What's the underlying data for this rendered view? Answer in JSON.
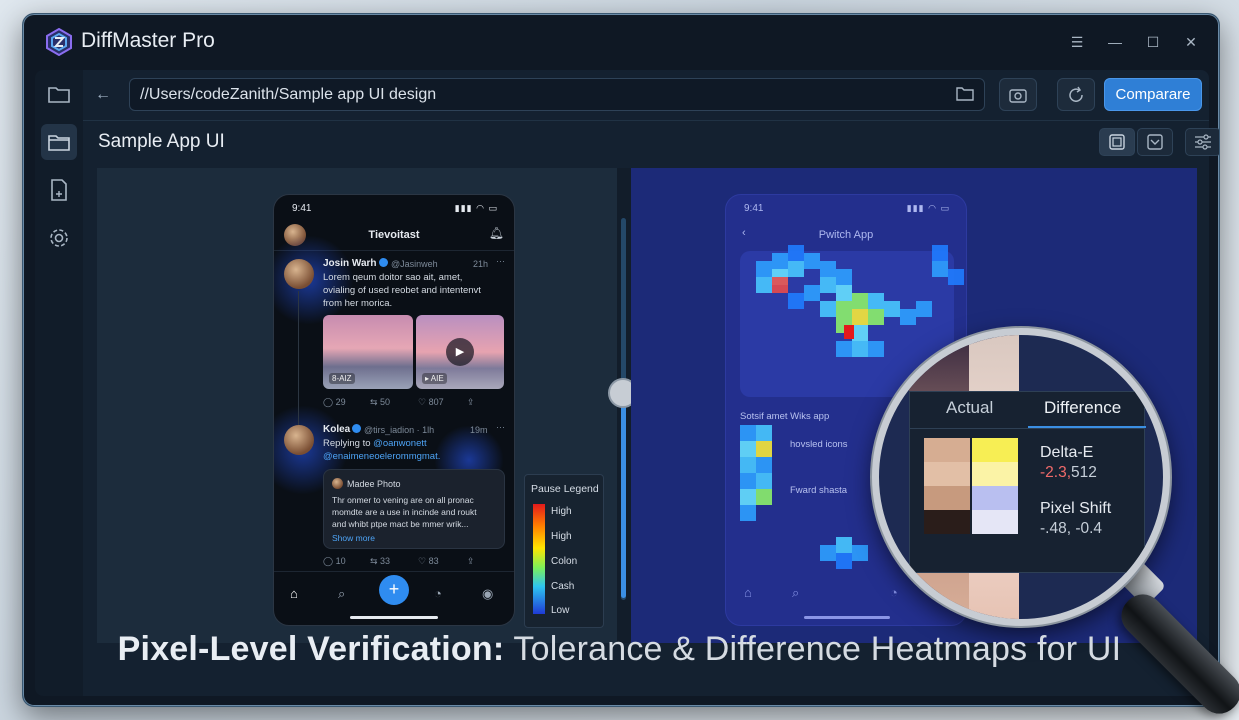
{
  "app": {
    "title": "DiffMaster Pro"
  },
  "toolbar": {
    "path": "//Users/codeZanith/Sample app UI design",
    "compare_label": "Comparare"
  },
  "subbar": {
    "title": "Sample App UI"
  },
  "left_phone": {
    "time": "9:41",
    "header_title": "Tievoitast",
    "post1": {
      "name": "Josin Warh",
      "handle": "@Jasinweh",
      "age": "21h",
      "text_lines": [
        "Lorem qeum doitor sao ait, amet,",
        "ovialing of used reobet and intentenvt",
        "from her morica."
      ],
      "img1_tag": "8-AIZ",
      "img2_tag": "▸ AIE",
      "actions": [
        "29",
        "50",
        "807"
      ]
    },
    "post2": {
      "name": "Kolea",
      "handle": "@tirs_iadion · 1lh",
      "age": "19m",
      "reply_label": "Replying to",
      "reply_to": "@oanwonett",
      "reply_line2": "@enaimeneoelerommgmat.",
      "quote_name": "Madee Photo",
      "quote_lines": [
        "Thr onmer to vening are on all pronac",
        "momdte are a use in incinde and roukt",
        "and whibt ptpe mact be mmer wrik..."
      ],
      "show_more": "Show more",
      "actions": [
        "10",
        "33",
        "83"
      ]
    }
  },
  "legend": {
    "title": "Pause Legend",
    "items": [
      "High",
      "High",
      "Colon",
      "Cash",
      "Low"
    ]
  },
  "right_phone": {
    "time": "9:41",
    "header_title": "Pwitch App",
    "section": "Sotsif amet Wiks app",
    "item1": "hovsled icons",
    "item2": "Fward shasta"
  },
  "magnifier": {
    "tab_actual": "Actual",
    "tab_difference": "Difference",
    "delta_label": "Delta-E",
    "delta_value_neg": "-2.3,",
    "delta_value_rest": "512",
    "shift_label": "Pixel Shift",
    "shift_value": "-.48, -0.4"
  },
  "caption": {
    "bold": "Pixel-Level Verification:",
    "rest": " Tolerance & Difference Heatmaps for UI"
  },
  "colors": {
    "accent": "#2f7fd6",
    "heat_high": "#e31a1c",
    "heat_low": "#1f3bd6"
  }
}
